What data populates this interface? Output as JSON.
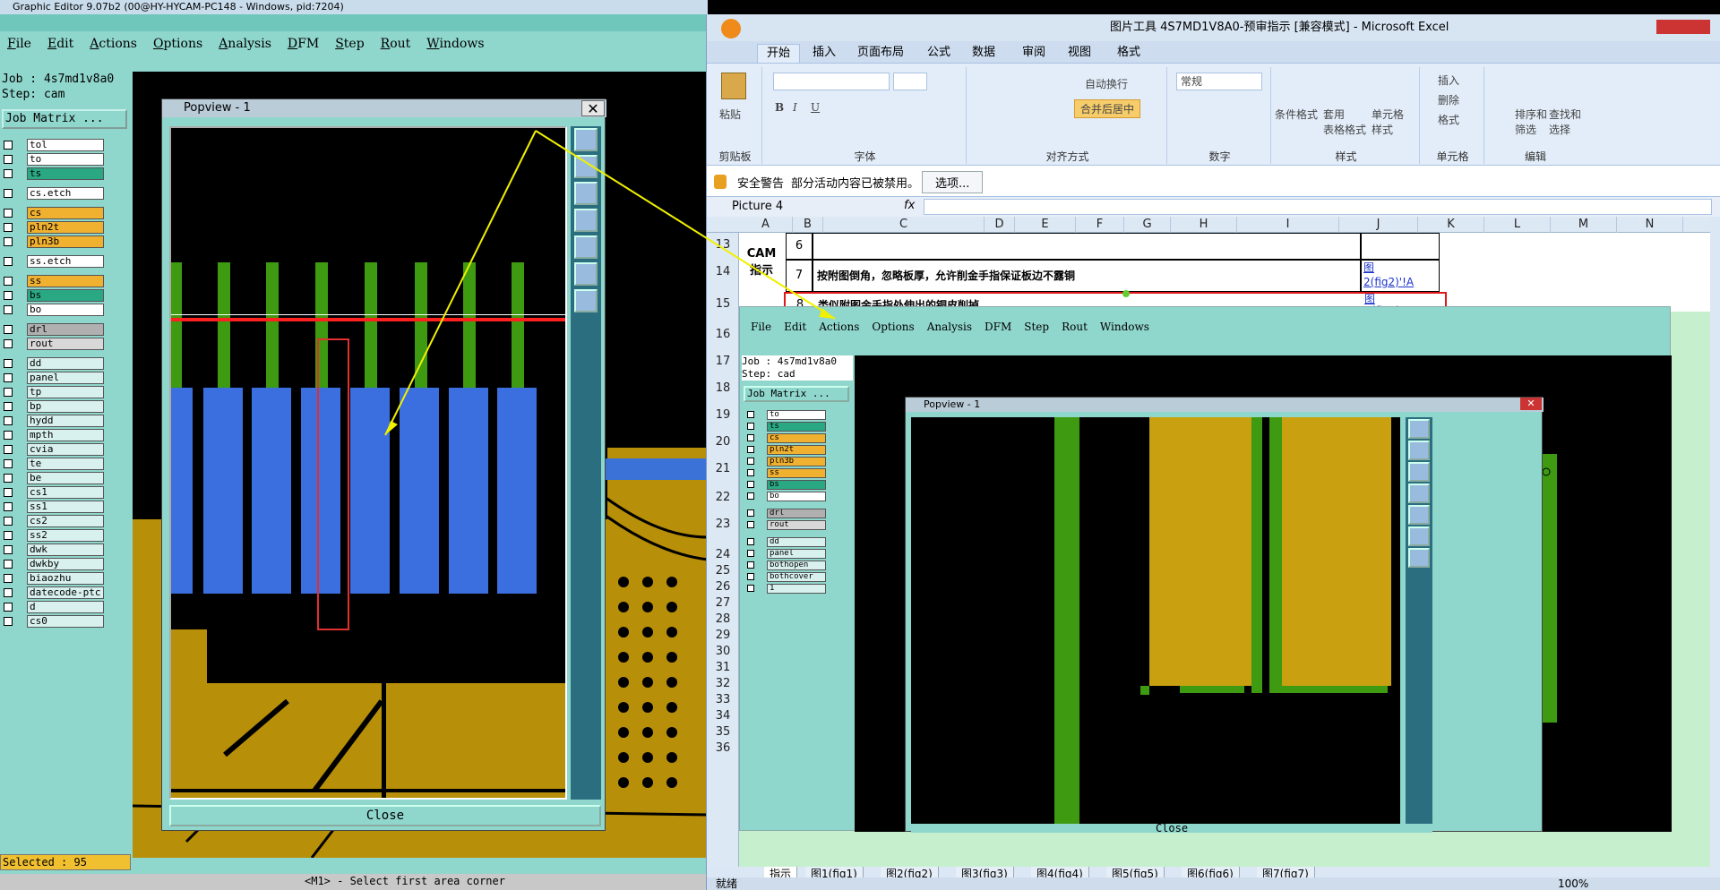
{
  "graphic_editor": {
    "title": "Graphic Editor 9.07b2 (00@HY-HYCAM-PC148 - Windows, pid:7204)",
    "menu": [
      "File",
      "Edit",
      "Actions",
      "Options",
      "Analysis",
      "DFM",
      "Step",
      "Rout",
      "Windows"
    ],
    "job_line": "Job : 4s7md1v8a0",
    "step_line": "Step: cam",
    "job_matrix_button": "Job Matrix ...",
    "layers": [
      {
        "name": "tol",
        "color": "#ffffff"
      },
      {
        "name": "to",
        "color": "#ffffff"
      },
      {
        "name": "ts",
        "color": "#2aa884"
      },
      {
        "name": "cs.etch",
        "color": "#ffffff",
        "gap": true
      },
      {
        "name": "cs",
        "color": "#f0b030",
        "gap": true
      },
      {
        "name": "pln2t",
        "color": "#f0b030"
      },
      {
        "name": "pln3b",
        "color": "#f0b030"
      },
      {
        "name": "ss.etch",
        "color": "#ffffff",
        "gap": true
      },
      {
        "name": "ss",
        "color": "#f0b030",
        "gap": true
      },
      {
        "name": "bs",
        "color": "#2aa884"
      },
      {
        "name": "bo",
        "color": "#ffffff"
      },
      {
        "name": "drl",
        "color": "#b0b0b0",
        "gap": true
      },
      {
        "name": "rout",
        "color": "#d8d8d8"
      },
      {
        "name": "dd",
        "color": "#d8f0ee",
        "gap": true
      },
      {
        "name": "panel",
        "color": "#d8f0ee"
      },
      {
        "name": "tp",
        "color": "#d8f0ee"
      },
      {
        "name": "bp",
        "color": "#d8f0ee"
      },
      {
        "name": "hydd",
        "color": "#d8f0ee"
      },
      {
        "name": "mpth",
        "color": "#d8f0ee"
      },
      {
        "name": "cvia",
        "color": "#d8f0ee"
      },
      {
        "name": "te",
        "color": "#d8f0ee"
      },
      {
        "name": "be",
        "color": "#d8f0ee"
      },
      {
        "name": "cs1",
        "color": "#d8f0ee"
      },
      {
        "name": "ss1",
        "color": "#d8f0ee"
      },
      {
        "name": "cs2",
        "color": "#d8f0ee"
      },
      {
        "name": "ss2",
        "color": "#d8f0ee"
      },
      {
        "name": "dwk",
        "color": "#d8f0ee"
      },
      {
        "name": "dwkby",
        "color": "#d8f0ee"
      },
      {
        "name": "biaozhu",
        "color": "#d8f0ee"
      },
      {
        "name": "datecode-ptc",
        "color": "#d8f0ee"
      },
      {
        "name": "d",
        "color": "#d8f0ee"
      },
      {
        "name": "cs0",
        "color": "#d8f0ee"
      }
    ],
    "status_selected": "Selected : 95",
    "bottom_hint": "<M1> - Select first area corner",
    "popview": {
      "title": "Popview - 1",
      "close_label": "Close"
    }
  },
  "excel": {
    "window_title": "图片工具    4S7MD1V8A0-预审指示  [兼容模式] - Microsoft Excel",
    "ribbon_tabs": [
      "开始",
      "插入",
      "页面布局",
      "公式",
      "数据",
      "审阅",
      "视图",
      "格式"
    ],
    "groups": [
      "剪贴板",
      "字体",
      "对齐方式",
      "数字",
      "样式",
      "单元格",
      "编辑"
    ],
    "clipboard_paste": "粘贴",
    "wrap_text": "自动换行",
    "merge_center": "合并后居中",
    "number_format": "常规",
    "style_buttons": [
      "条件格式",
      "套用\n表格格式",
      "单元格\n样式"
    ],
    "cell_buttons": [
      "插入",
      "删除",
      "格式"
    ],
    "edit_buttons": [
      "排序和\n筛选",
      "查找和\n选择"
    ],
    "security_label": "安全警告",
    "security_msg": "部分活动内容已被禁用。",
    "security_options": "选项...",
    "name_box": "Picture 4",
    "fx": "fx",
    "columns": [
      "A",
      "B",
      "C",
      "D",
      "E",
      "F",
      "G",
      "H",
      "I",
      "J",
      "K",
      "L",
      "M",
      "N"
    ],
    "rows": [
      "13",
      "14",
      "15",
      "16",
      "17",
      "18",
      "19",
      "20",
      "21",
      "22",
      "23",
      "24",
      "25",
      "26",
      "27",
      "28",
      "29",
      "30",
      "31",
      "32",
      "33",
      "34",
      "35",
      "36"
    ],
    "cam_label": "CAM\n指示",
    "items": [
      {
        "num": "6",
        "text": "",
        "link": ""
      },
      {
        "num": "7",
        "text": "按附图倒角，忽略板厚，允许削金手指保证板边不露铜",
        "link": "图\n2(fig2)'!A"
      },
      {
        "num": "8",
        "text": "类似附图金手指处伸出的铜皮削掉",
        "link": "图\n3(fig3)'!A"
      }
    ],
    "sheet_tabs": [
      "指示",
      "图1(fig1)",
      "图2(fig2)",
      "图3(fig3)",
      "图4(fig4)",
      "图5(fig5)",
      "图6(fig6)",
      "图7(fig7)"
    ],
    "status_ready": "就绪",
    "zoom": "100%"
  },
  "embedded_picture": {
    "menu": [
      "File",
      "Edit",
      "Actions",
      "Options",
      "Analysis",
      "DFM",
      "Step",
      "Rout",
      "Windows"
    ],
    "job_line": "Job : 4s7md1v8a0",
    "step_line": "Step: cad",
    "job_matrix_button": "Job Matrix ...",
    "layers": [
      {
        "name": "to",
        "color": "#ffffff"
      },
      {
        "name": "ts",
        "color": "#2aa884"
      },
      {
        "name": "cs",
        "color": "#f0b030"
      },
      {
        "name": "pln2t",
        "color": "#f0b030"
      },
      {
        "name": "pln3b",
        "color": "#f0b030"
      },
      {
        "name": "ss",
        "color": "#f0b030"
      },
      {
        "name": "bs",
        "color": "#2aa884"
      },
      {
        "name": "bo",
        "color": "#ffffff"
      },
      {
        "name": "drl",
        "color": "#b0b0b0",
        "gap": true
      },
      {
        "name": "rout",
        "color": "#d8d8d8"
      },
      {
        "name": "dd",
        "color": "#d8f0ee",
        "gap": true
      },
      {
        "name": "panel",
        "color": "#d8f0ee"
      },
      {
        "name": "bothopen",
        "color": "#d8f0ee"
      },
      {
        "name": "bothcover",
        "color": "#d8f0ee"
      },
      {
        "name": "1",
        "color": "#d8f0ee"
      }
    ],
    "popview_title": "Popview - 1",
    "close_label": "Close"
  }
}
